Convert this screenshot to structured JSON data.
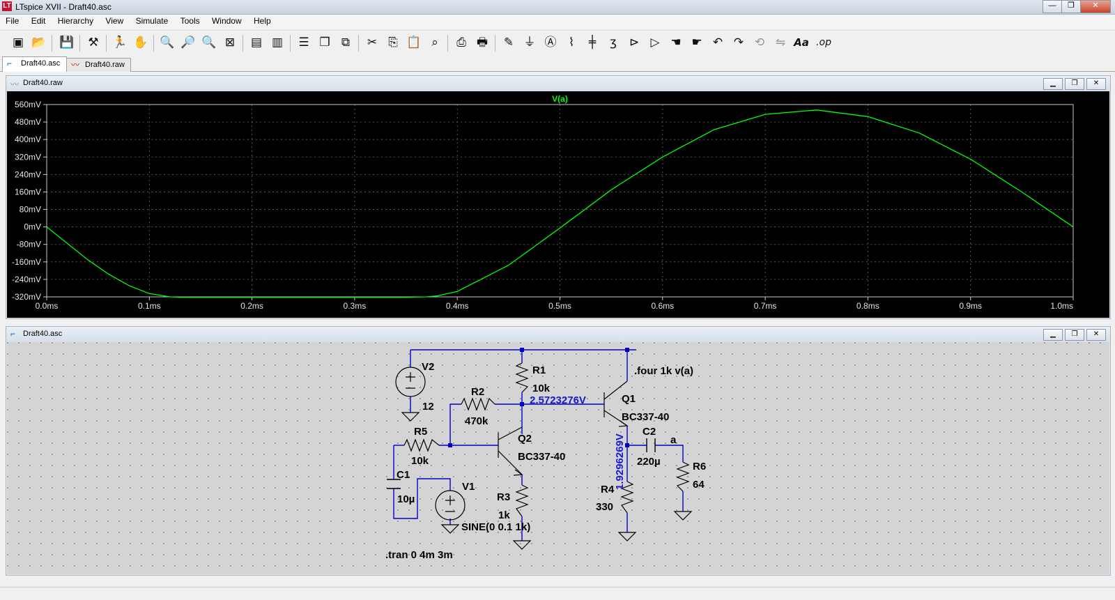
{
  "window": {
    "title": "LTspice XVII - Draft40.asc",
    "app_icon_text": "LT"
  },
  "window_controls": {
    "minimize": "—",
    "restore": "❐",
    "close": "✕"
  },
  "menu": [
    "File",
    "Edit",
    "Hierarchy",
    "View",
    "Simulate",
    "Tools",
    "Window",
    "Help"
  ],
  "tabs": [
    {
      "label": "Draft40.asc",
      "icon": "schematic-icon"
    },
    {
      "label": "Draft40.raw",
      "icon": "waveform-icon"
    }
  ],
  "toolbar": {
    "op_label": ".op",
    "text_label": "Aa"
  },
  "waveform_window": {
    "title": "Draft40.raw",
    "trace_label": "V(a)",
    "trace_color": "#00ff00"
  },
  "schematic_window": {
    "title": "Draft40.asc"
  },
  "chart_data": {
    "type": "line",
    "title": "V(a)",
    "xlim": [
      0,
      1.0
    ],
    "ylim": [
      -320,
      560
    ],
    "x_ticks": [
      "0.0ms",
      "0.1ms",
      "0.2ms",
      "0.3ms",
      "0.4ms",
      "0.5ms",
      "0.6ms",
      "0.7ms",
      "0.8ms",
      "0.9ms",
      "1.0ms"
    ],
    "y_ticks": [
      "560mV",
      "480mV",
      "400mV",
      "320mV",
      "240mV",
      "160mV",
      "80mV",
      "0mV",
      "-80mV",
      "-160mV",
      "-240mV",
      "-320mV"
    ],
    "grid": true,
    "series": [
      {
        "name": "V(a)",
        "color": "#00ff00",
        "x": [
          0,
          0.02,
          0.04,
          0.06,
          0.08,
          0.1,
          0.12,
          0.13,
          0.15,
          0.2,
          0.25,
          0.3,
          0.35,
          0.37,
          0.38,
          0.4,
          0.45,
          0.5,
          0.55,
          0.6,
          0.65,
          0.7,
          0.75,
          0.8,
          0.85,
          0.9,
          0.95,
          1.0
        ],
        "y": [
          0,
          -75,
          -150,
          -215,
          -268,
          -305,
          -320,
          -322,
          -322,
          -322,
          -322,
          -322,
          -322,
          -320,
          -316,
          -295,
          -175,
          -5,
          170,
          320,
          445,
          515,
          535,
          505,
          430,
          310,
          160,
          0
        ]
      }
    ]
  },
  "schematic": {
    "v2": {
      "name": "V2",
      "value": "12"
    },
    "r1": {
      "name": "R1",
      "value": "10k"
    },
    "r2": {
      "name": "R2",
      "value": "470k"
    },
    "r3": {
      "name": "R3",
      "value": "1k"
    },
    "r4": {
      "name": "R4",
      "value": "330"
    },
    "r5": {
      "name": "R5",
      "value": "10k"
    },
    "r6": {
      "name": "R6",
      "value": "64"
    },
    "c1": {
      "name": "C1",
      "value": "10µ"
    },
    "c2": {
      "name": "C2",
      "value": "220µ"
    },
    "q1": {
      "name": "Q1",
      "model": "BC337-40"
    },
    "q2": {
      "name": "Q2",
      "model": "BC337-40"
    },
    "v1": {
      "name": "V1",
      "value": "SINE(0 0.1 1k)"
    },
    "net_a": "a",
    "directive_four": ".four 1k v(a)",
    "directive_tran": ".tran 0 4m 3m",
    "op_voltage_1": "2.5723276V",
    "op_voltage_2": "1.9296269V"
  }
}
